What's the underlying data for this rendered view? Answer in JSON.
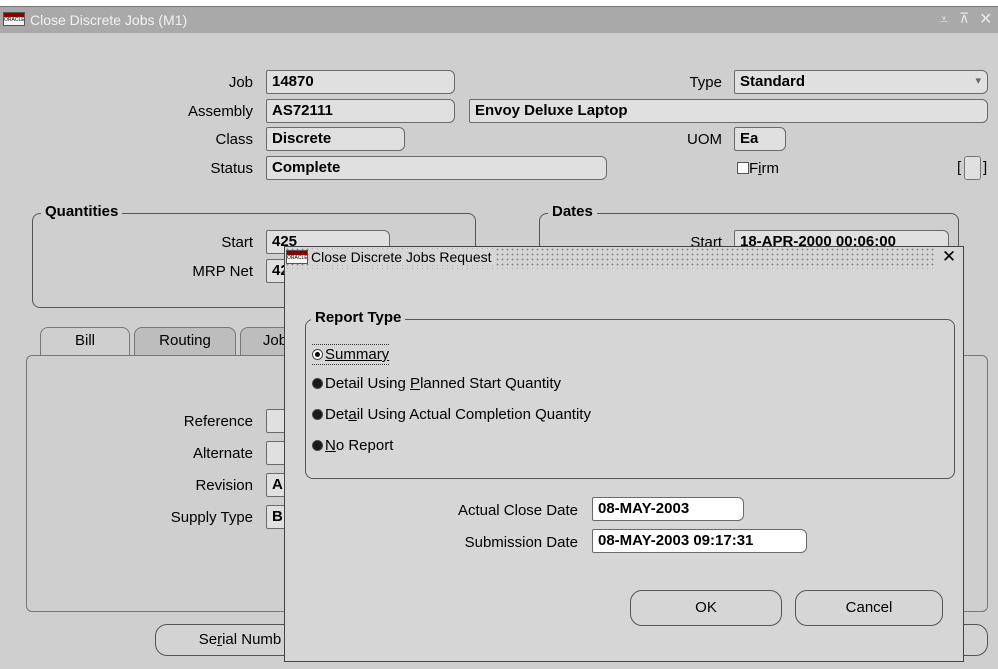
{
  "main_window": {
    "title": "Close Discrete Jobs (M1)",
    "icon_text": "ORACLE",
    "window_controls": [
      "minimize-icon",
      "maximize-icon",
      "close-icon"
    ],
    "header": {
      "job_label": "Job",
      "job_value": "14870",
      "type_label": "Type",
      "type_value": "Standard",
      "assembly_label": "Assembly",
      "assembly_value": "AS72111",
      "assembly_desc": "Envoy Deluxe Laptop",
      "class_label": "Class",
      "class_value": "Discrete",
      "uom_label": "UOM",
      "uom_value": "Ea",
      "status_label": "Status",
      "status_value": "Complete",
      "firm_label_pre": "F",
      "firm_label_ul": "i",
      "firm_label_post": "rm",
      "dff_open": "[",
      "dff_close": "]"
    },
    "quantities": {
      "title": "Quantities",
      "start_label": "Start",
      "start_value": "425",
      "mrp_label": "MRP Net",
      "mrp_value": "42"
    },
    "dates": {
      "title": "Dates",
      "start_label": "Start",
      "start_value": "18-APR-2000 00:06:00"
    },
    "tabs": [
      "Bill",
      "Routing",
      "Job"
    ],
    "bill_tab": {
      "reference_label": "Reference",
      "alternate_label": "Alternate",
      "revision_label": "Revision",
      "revision_value": "A",
      "supply_type_label": "Supply Type",
      "supply_type_value": "B"
    },
    "serial_button_pre": "Se",
    "serial_button_ul": "r",
    "serial_button_post": "ial Numb"
  },
  "dialog": {
    "title": "Close Discrete Jobs Request",
    "icon_text": "ORACLE",
    "report_type_title": "Report Type",
    "options": [
      {
        "pre": "",
        "ul": "S",
        "post": "ummary",
        "selected": true
      },
      {
        "pre": "Detail Using ",
        "ul": "P",
        "post": "lanned Start Quantity",
        "selected": false
      },
      {
        "pre": "Det",
        "ul": "a",
        "post": "il Using Actual Completion Quantity",
        "selected": false
      },
      {
        "pre": "",
        "ul": "N",
        "post": "o Report",
        "selected": false
      }
    ],
    "actual_close_date_label": "Actual Close Date",
    "actual_close_date_value": "08-MAY-2003",
    "submission_date_label": "Submission Date",
    "submission_date_value": "08-MAY-2003 09:17:31",
    "ok_label": "OK",
    "cancel_label": "Cancel"
  }
}
